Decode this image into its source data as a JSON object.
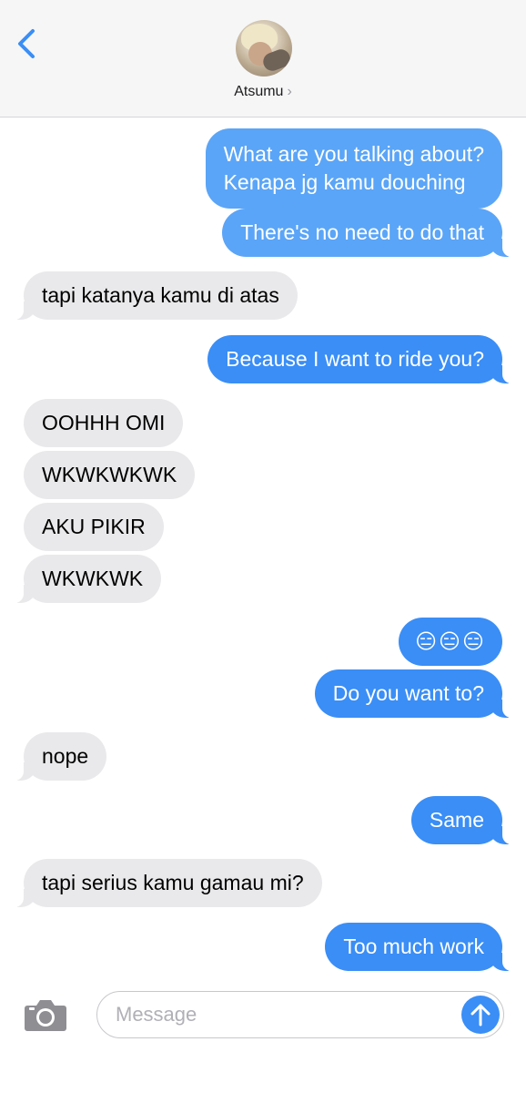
{
  "header": {
    "contact_name": "Atsumu",
    "chevron": "›"
  },
  "messages": [
    {
      "side": "out",
      "lines": [
        "What are you talking about?",
        "Kenapa jg kamu douching"
      ]
    },
    {
      "side": "out",
      "text": "There's no need to do that"
    },
    {
      "side": "in",
      "text": "tapi katanya kamu di atas"
    },
    {
      "side": "out",
      "text": "Because I want to ride you?"
    },
    {
      "side": "in",
      "text": "OOHHH OMI"
    },
    {
      "side": "in",
      "text": "WKWKWKWK"
    },
    {
      "side": "in",
      "text": "AKU PIKIR"
    },
    {
      "side": "in",
      "text": "WKWKWK"
    },
    {
      "side": "out",
      "text": "😑😑😑"
    },
    {
      "side": "out",
      "text": "Do you want to?"
    },
    {
      "side": "in",
      "text": "nope"
    },
    {
      "side": "out",
      "text": "Same"
    },
    {
      "side": "in",
      "text": "tapi serius kamu gamau mi?"
    },
    {
      "side": "out",
      "text": "Too much work"
    }
  ],
  "composer": {
    "placeholder": "Message"
  },
  "icons": {
    "back": "chevron-left-icon",
    "camera": "camera-icon",
    "send": "arrow-up-icon"
  },
  "colors": {
    "outgoing": "#3a8ef6",
    "incoming": "#e9e9eb",
    "accent": "#3a8ef6"
  }
}
